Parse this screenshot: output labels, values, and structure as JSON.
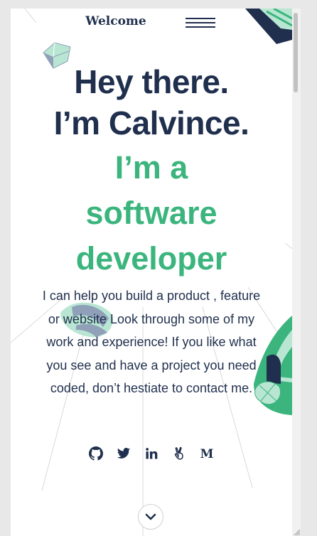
{
  "header": {
    "brand": "Welcome",
    "menu_icon": "hamburger-icon"
  },
  "hero": {
    "greeting_line1": "Hey there.",
    "greeting_line2": "I’m Calvince.",
    "role_line1": "I’m a",
    "role_line2": "software",
    "role_line3": "developer",
    "description": "I can help you build a product , feature or website Look through some of my work and experience! If you like what you see and have a project you need coded, don’t hestiate to contact me."
  },
  "social_links": [
    {
      "name": "github",
      "icon": "github-icon"
    },
    {
      "name": "twitter",
      "icon": "twitter-icon"
    },
    {
      "name": "linkedin",
      "icon": "linkedin-icon"
    },
    {
      "name": "angellist",
      "icon": "angellist-icon"
    },
    {
      "name": "medium",
      "icon": "medium-icon",
      "glyph": "M"
    }
  ],
  "scroll_button": {
    "icon": "chevron-down-icon"
  },
  "colors": {
    "primary_text": "#1f2f4d",
    "accent": "#3bb57d",
    "mint": "#b9e6d3",
    "background": "#ffffff"
  }
}
